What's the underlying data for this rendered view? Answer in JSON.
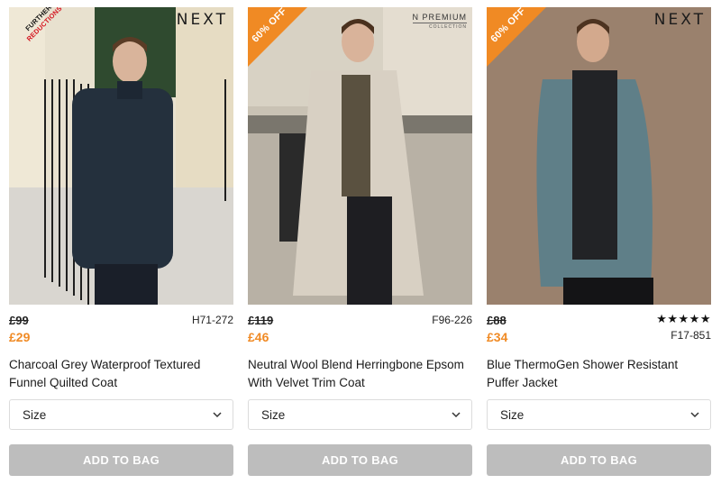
{
  "colors": {
    "sale_orange": "#f08a24",
    "reduction_red": "#d4141f",
    "button_grey": "#bdbdbd"
  },
  "products": [
    {
      "brand_mark": "NEXT",
      "badge_line1": "FURTHER",
      "badge_line2": "REDUCTIONS",
      "old_price": "£99",
      "new_price": "£29",
      "code": "H71-272",
      "title": "Charcoal Grey Waterproof Textured Funnel Quilted Coat",
      "size_label": "Size",
      "size_icon": "chevron-down-icon",
      "add_label": "ADD TO BAG"
    },
    {
      "brand_mark": "N PREMIUM",
      "brand_sub": "COLLECTION",
      "badge": "60% OFF",
      "old_price": "£119",
      "new_price": "£46",
      "code": "F96-226",
      "title": "Neutral Wool Blend Herringbone Epsom With Velvet Trim Coat",
      "size_label": "Size",
      "size_icon": "chevron-down-icon",
      "add_label": "ADD TO BAG"
    },
    {
      "brand_mark": "NEXT",
      "badge": "60% OFF",
      "old_price": "£88",
      "new_price": "£34",
      "rating": 5,
      "rating_max": 5,
      "stars": "★★★★★",
      "code": "F17-851",
      "title": "Blue ThermoGen Shower Resistant Puffer Jacket",
      "size_label": "Size",
      "size_icon": "chevron-down-icon",
      "add_label": "ADD TO BAG"
    }
  ]
}
